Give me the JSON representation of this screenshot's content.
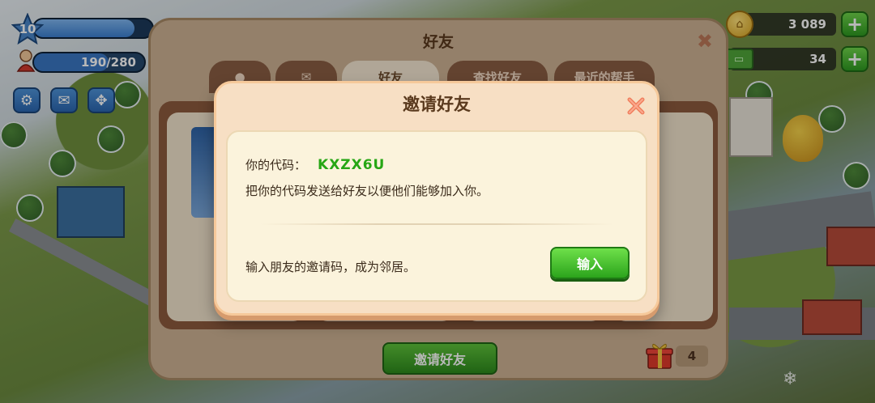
{
  "hud": {
    "level": "10",
    "xp_progress": 0.85,
    "population": "190/280",
    "population_progress": 0.68,
    "buttons": [
      {
        "name": "settings-gear-icon",
        "glyph": "⚙"
      },
      {
        "name": "mail-icon",
        "glyph": "✉"
      },
      {
        "name": "move-arrows-icon",
        "glyph": "✥"
      }
    ],
    "coins": "3 089",
    "cash": "34"
  },
  "friends_panel": {
    "title": "好友",
    "tabs": [
      "",
      "",
      "好友",
      "查找好友",
      "最近的帮手"
    ],
    "active_tab": 2,
    "invite_button": "邀请好友",
    "gift_count": "4"
  },
  "dialog": {
    "title": "邀请好友",
    "code_label": "你的代码：",
    "code_value": "KXZX6U",
    "share_text": "把你的代码发送给好友以便他们能够加入你。",
    "enter_text": "输入朋友的邀请码，成为邻居。",
    "enter_button": "输入"
  },
  "colors": {
    "accent_green": "#2ca41c",
    "code_green": "#26a614",
    "panel_brown": "#8d5a3e",
    "dialog_bg": "#f7dfc4"
  }
}
